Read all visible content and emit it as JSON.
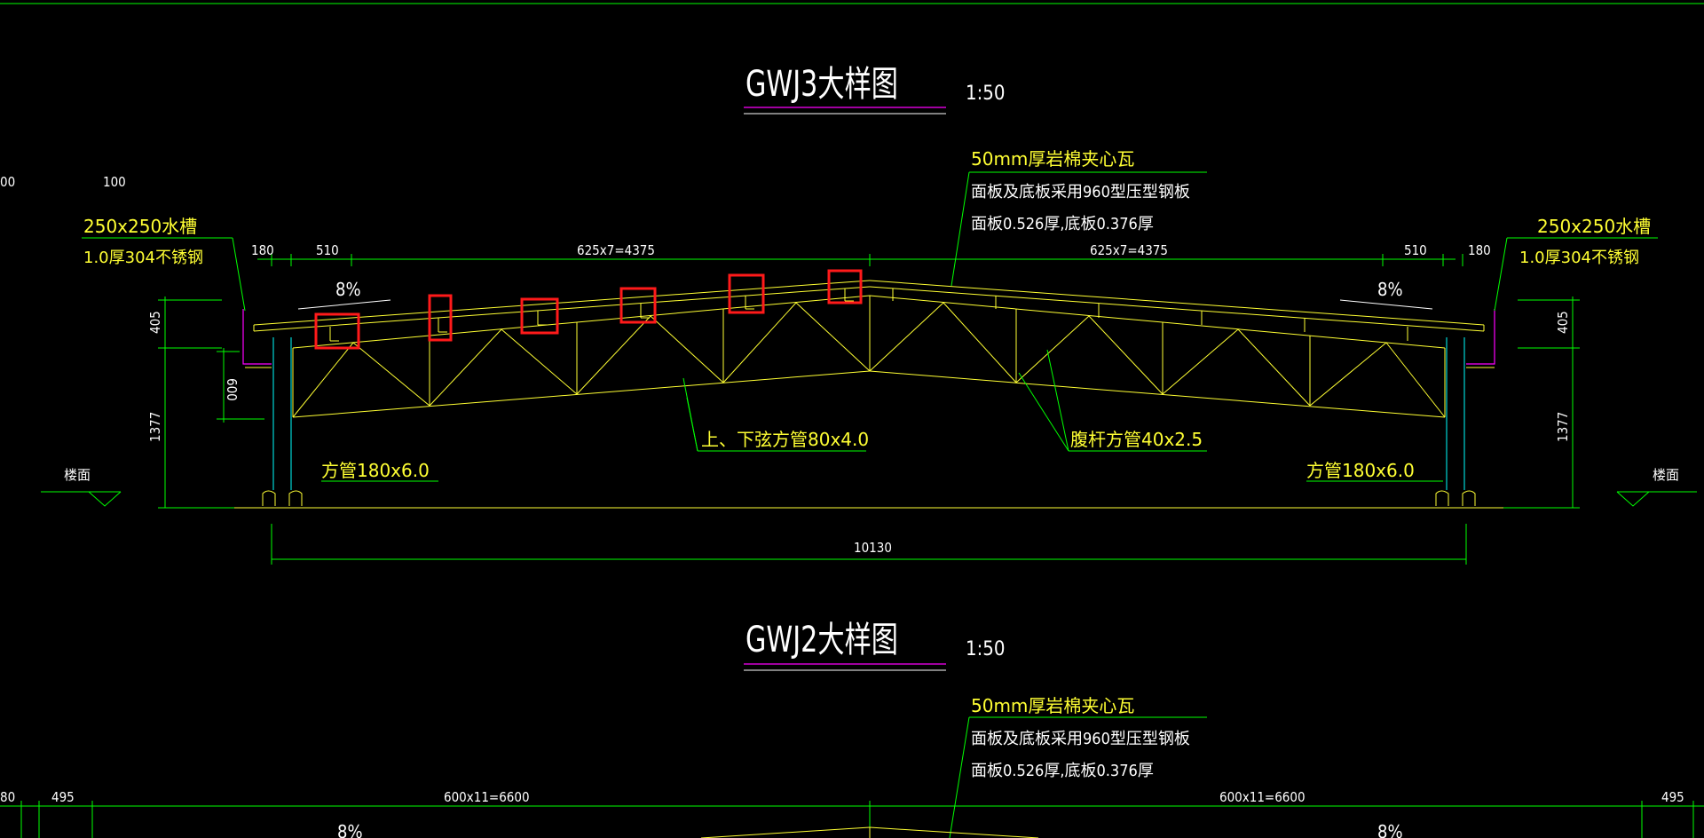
{
  "drawing1": {
    "title": "GWJ3大样图",
    "scale": "1:50",
    "dims": {
      "left_180": "180",
      "left_510": "510",
      "left_span": "625x7=4375",
      "right_span": "625x7=4375",
      "right_510": "510",
      "right_180": "180",
      "total": "10130",
      "height_405_left": "405",
      "height_1377_left": "1377",
      "height_600": "600",
      "height_405_right": "405",
      "height_1377_right": "1377",
      "top_100": "100",
      "top_00": "00"
    },
    "slope_left": "8%",
    "slope_right": "8%",
    "notes": {
      "roof_line1": "50mm厚岩棉夹心瓦",
      "roof_line2": "面板及底板采用960型压型钢板",
      "roof_line3": "面板0.526厚,底板0.376厚",
      "gutter_left_1": "250x250水槽",
      "gutter_left_2": "1.0厚304不锈钢",
      "gutter_right_1": "250x250水槽",
      "gutter_right_2": "1.0厚304不锈钢",
      "chord": "上、下弦方管80x4.0",
      "web": "腹杆方管40x2.5",
      "column_left": "方管180x6.0",
      "column_right": "方管180x6.0",
      "floor_left": "楼面",
      "floor_right": "楼面"
    }
  },
  "drawing2": {
    "title": "GWJ2大样图",
    "scale": "1:50",
    "dims": {
      "left_80": "80",
      "left_495": "495",
      "left_span": "600x11=6600",
      "right_span": "600x11=6600",
      "right_495": "495"
    },
    "slope_left": "8%",
    "slope_right": "8%",
    "notes": {
      "roof_line1": "50mm厚岩棉夹心瓦",
      "roof_line2": "面板及底板采用960型压型钢板",
      "roof_line3": "面板0.526厚,底板0.376厚"
    }
  },
  "colors": {
    "background": "#000000",
    "dimension": "#00ff00",
    "structure": "#ffff33",
    "column": "#00ffff",
    "gutter": "#ff00ff",
    "highlight": "#ff1a1a",
    "text": "#ffffff"
  }
}
